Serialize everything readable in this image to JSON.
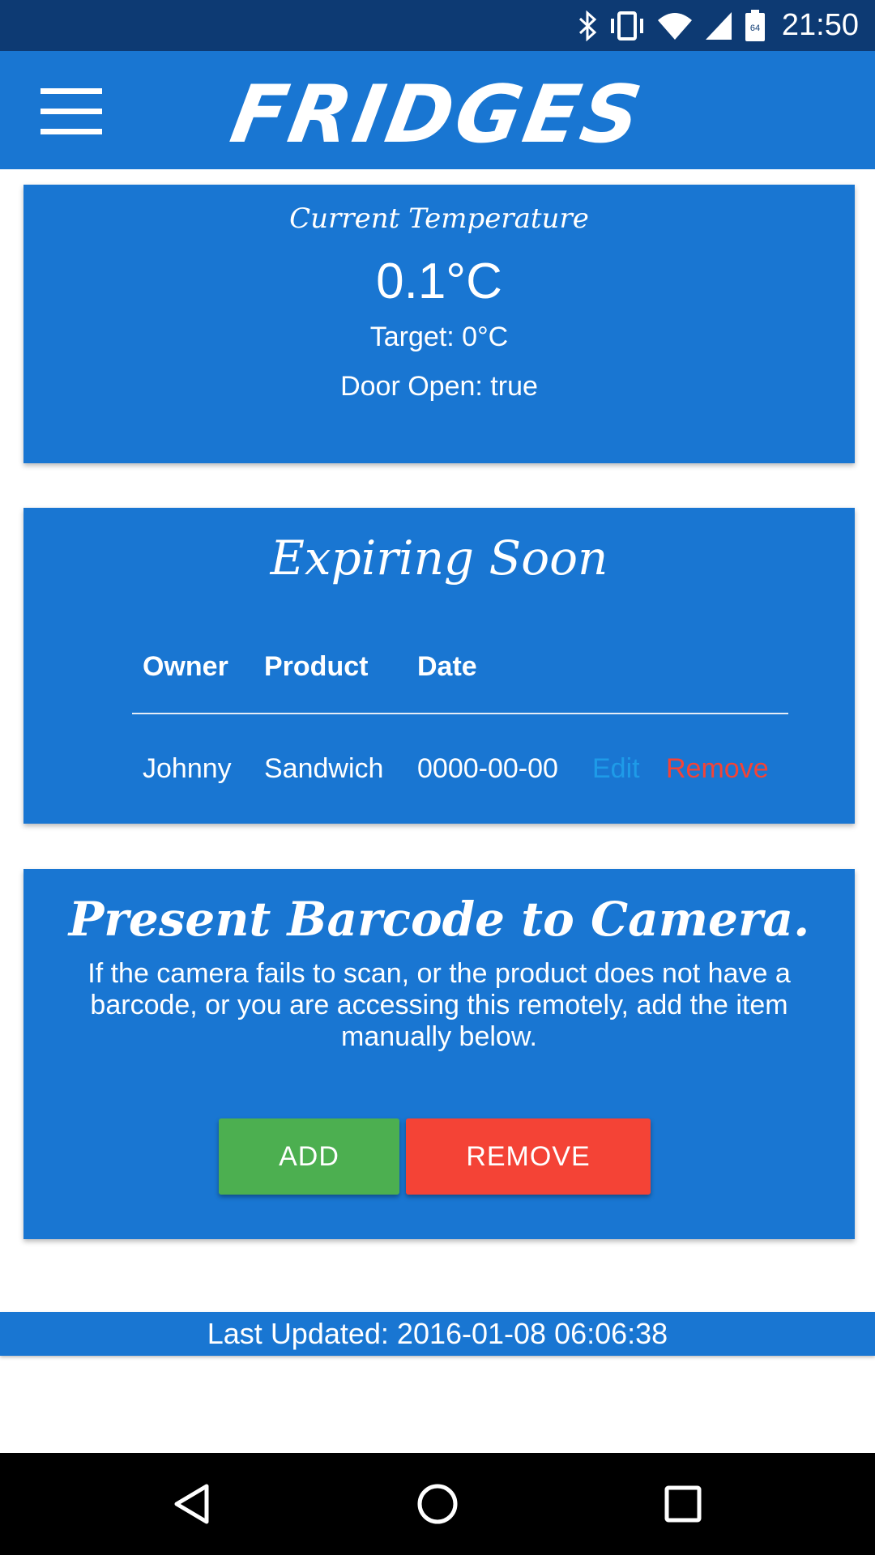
{
  "status_bar": {
    "time": "21:50",
    "battery_level_text": "64",
    "icons": [
      "bluetooth-icon",
      "vibrate-icon",
      "wifi-icon",
      "cell-signal-icon",
      "battery-icon"
    ]
  },
  "app_bar": {
    "title": "FRIDGES",
    "menu_icon": "hamburger-menu-icon"
  },
  "temperature_card": {
    "heading": "Current Temperature",
    "current": "0.1°C",
    "target": "Target: 0°C",
    "door": "Door Open: true"
  },
  "expiring_card": {
    "heading": "Expiring Soon",
    "columns": [
      "Owner",
      "Product",
      "Date"
    ],
    "rows": [
      {
        "owner": "Johnny",
        "product": "Sandwich",
        "date": "0000-00-00",
        "edit": "Edit",
        "remove": "Remove"
      }
    ]
  },
  "barcode_card": {
    "heading": "Present Barcode to Camera.",
    "description": "If the camera fails to scan, or the product does not have a barcode, or you are accessing this remotely, add the item manually below.",
    "add_label": "ADD",
    "remove_label": "REMOVE"
  },
  "footer": {
    "last_updated": "Last Updated: 2016-01-08 06:06:38"
  },
  "nav_bar": {
    "icons": [
      "back-icon",
      "home-icon",
      "recents-icon"
    ]
  },
  "colors": {
    "primary": "#1976d2",
    "status_bar": "#0d3a73",
    "add_green": "#4caf50",
    "remove_red": "#f44336",
    "edit_link": "#1e9be8"
  }
}
